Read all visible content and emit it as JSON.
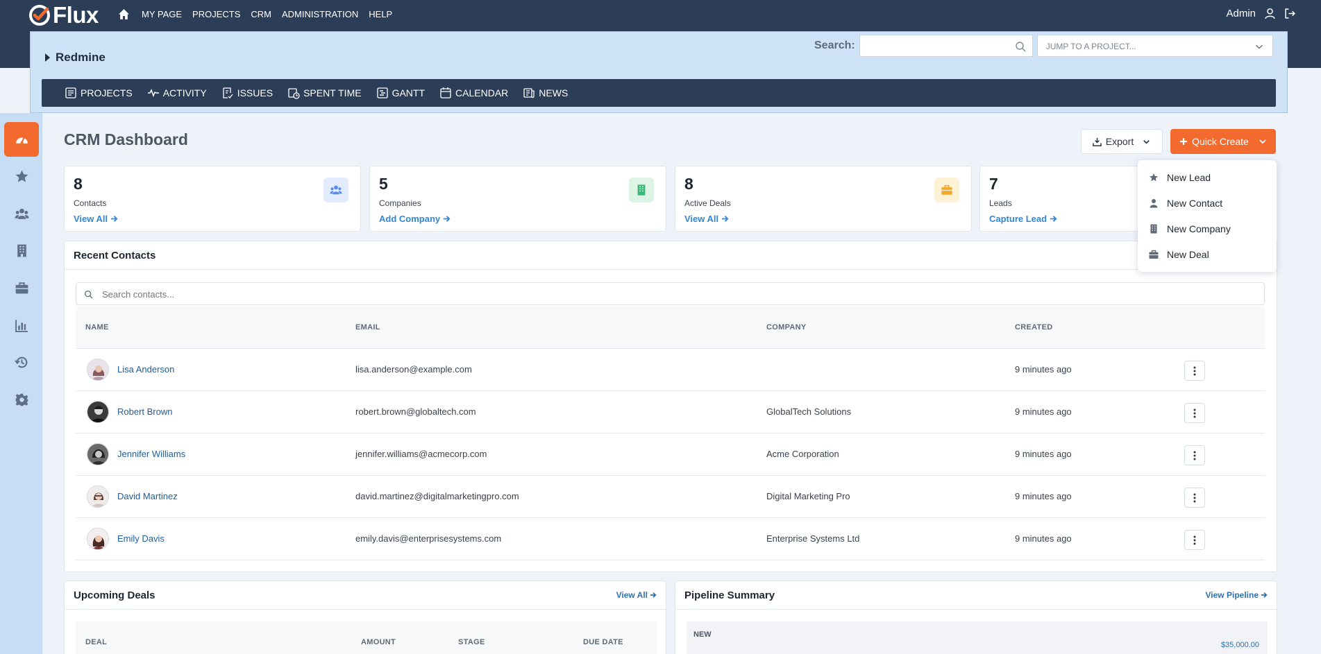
{
  "app": {
    "name": "Flux"
  },
  "topnav": {
    "items": [
      "MY PAGE",
      "PROJECTS",
      "CRM",
      "ADMINISTRATION",
      "HELP"
    ]
  },
  "user": {
    "name": "Admin"
  },
  "project": {
    "name": "Redmine",
    "search_label": "Search:",
    "search_value": "",
    "jump_placeholder": "JUMP TO A PROJECT...",
    "menu": [
      "PROJECTS",
      "ACTIVITY",
      "ISSUES",
      "SPENT TIME",
      "GANTT",
      "CALENDAR",
      "NEWS"
    ]
  },
  "sidebar": {
    "items": [
      "dashboard",
      "favorites",
      "contacts",
      "companies",
      "deals",
      "reports",
      "history",
      "settings"
    ],
    "active": "dashboard"
  },
  "page": {
    "title": "CRM Dashboard",
    "export_label": "Export",
    "quick_create_label": "Quick Create"
  },
  "stats": [
    {
      "value": "8",
      "label": "Contacts",
      "link": "View All",
      "icon": "users-icon",
      "color": "#5b8def"
    },
    {
      "value": "5",
      "label": "Companies",
      "link": "Add Company",
      "icon": "building-icon",
      "color": "#3cb878"
    },
    {
      "value": "8",
      "label": "Active Deals",
      "link": "View All",
      "icon": "briefcase-icon",
      "color": "#f0a82e"
    },
    {
      "value": "7",
      "label": "Leads",
      "link": "Capture Lead",
      "icon": "",
      "color": ""
    }
  ],
  "quick_create_menu": [
    "New Lead",
    "New Contact",
    "New Company",
    "New Deal"
  ],
  "recent_contacts": {
    "title": "Recent Contacts",
    "search_placeholder": "Search contacts...",
    "columns": [
      "NAME",
      "EMAIL",
      "COMPANY",
      "CREATED"
    ],
    "rows": [
      {
        "name": "Lisa Anderson",
        "email": "lisa.anderson@example.com",
        "company": "",
        "created": "9 minutes ago"
      },
      {
        "name": "Robert Brown",
        "email": "robert.brown@globaltech.com",
        "company": "GlobalTech Solutions",
        "created": "9 minutes ago"
      },
      {
        "name": "Jennifer Williams",
        "email": "jennifer.williams@acmecorp.com",
        "company": "Acme Corporation",
        "created": "9 minutes ago"
      },
      {
        "name": "David Martinez",
        "email": "david.martinez@digitalmarketingpro.com",
        "company": "Digital Marketing Pro",
        "created": "9 minutes ago"
      },
      {
        "name": "Emily Davis",
        "email": "emily.davis@enterprisesystems.com",
        "company": "Enterprise Systems Ltd",
        "created": "9 minutes ago"
      }
    ]
  },
  "upcoming_deals": {
    "title": "Upcoming Deals",
    "view_all": "View All",
    "columns": [
      "DEAL",
      "AMOUNT",
      "STAGE",
      "DUE DATE"
    ]
  },
  "pipeline_summary": {
    "title": "Pipeline Summary",
    "view_link": "View Pipeline",
    "stage": "NEW",
    "amount": "$35,000.00"
  },
  "colors": {
    "navbar": "#2c3e57",
    "accent": "#f26a2e",
    "link": "#2f86d6"
  }
}
